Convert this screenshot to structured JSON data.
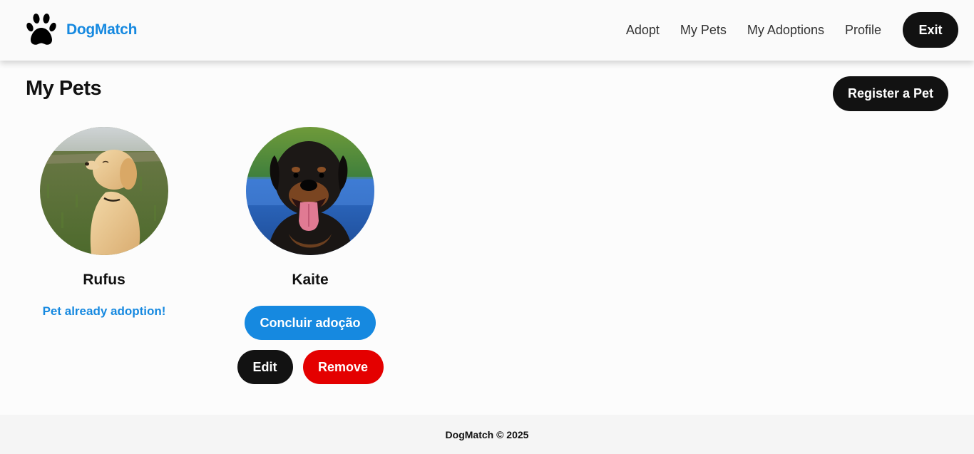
{
  "header": {
    "brand": "DogMatch",
    "logo_icon": "paw-icon",
    "nav": [
      "Adopt",
      "My Pets",
      "My Adoptions",
      "Profile"
    ],
    "exit_label": "Exit"
  },
  "main": {
    "title": "My Pets",
    "register_label": "Register a Pet",
    "pets": [
      {
        "name": "Rufus",
        "photo": "golden-retriever-puppy-photo",
        "status": "Pet already adoption!"
      },
      {
        "name": "Kaite",
        "photo": "rottweiler-photo",
        "conclude_label": "Concluir adoção",
        "edit_label": "Edit",
        "remove_label": "Remove"
      }
    ]
  },
  "footer": {
    "text": "DogMatch © 2025"
  },
  "colors": {
    "accent": "#1689e0",
    "dark": "#121212",
    "danger": "#e40000"
  }
}
